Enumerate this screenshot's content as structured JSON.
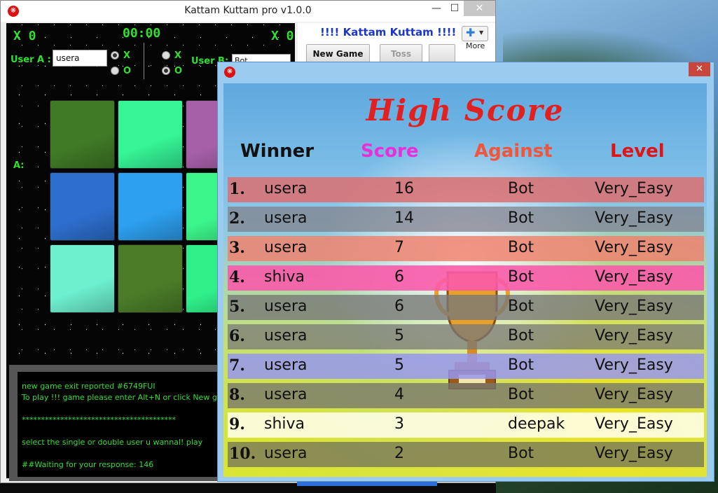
{
  "main_window": {
    "title": "Kattam Kuttam pro v1.0.0",
    "app_icon": "❋",
    "min": "—",
    "max": "☐",
    "close": "✕"
  },
  "game": {
    "score_a": "X 0",
    "score_b": "X 0",
    "timer": "00:00",
    "user_a_label": "User A :",
    "user_a_value": "usera",
    "user_b_label": "User B:",
    "user_b_value": "Bot",
    "x_label": "X",
    "o_label": "O",
    "side_label": "A:"
  },
  "right_panel": {
    "title": "!!!! Kattam Kuttam !!!!",
    "new_game": "New Game",
    "toss": "Toss",
    "more": "More"
  },
  "log": {
    "lines": [
      "new game exit reported #6749FUI",
      "To play !!! game please enter Alt+N or click New game",
      "****************************************",
      " select the single or double user u wannal! play",
      "##Waiting for your response: 146"
    ]
  },
  "high_score": {
    "title": "High Score",
    "close": "✕",
    "columns": [
      "Winner",
      "Score",
      "Against",
      "Level"
    ],
    "column_colors": [
      "#111111",
      "#ea2fd8",
      "#f2553a",
      "#e01414"
    ],
    "rows": [
      {
        "rank": "1.",
        "winner": "usera",
        "score": "16",
        "against": "Bot",
        "level": "Very_Easy",
        "color": "rgba(220,110,110,0.85)"
      },
      {
        "rank": "2.",
        "winner": "usera",
        "score": "14",
        "against": "Bot",
        "level": "Very_Easy",
        "color": "rgba(130,130,140,0.75)"
      },
      {
        "rank": "3.",
        "winner": "usera",
        "score": "7",
        "against": "Bot",
        "level": "Very_Easy",
        "color": "rgba(240,130,110,0.85)"
      },
      {
        "rank": "4.",
        "winner": "shiva",
        "score": "6",
        "against": "Bot",
        "level": "Very_Easy",
        "color": "rgba(250,90,170,0.9)"
      },
      {
        "rank": "5.",
        "winner": "usera",
        "score": "6",
        "against": "Bot",
        "level": "Very_Easy",
        "color": "rgba(120,120,120,0.8)"
      },
      {
        "rank": "6.",
        "winner": "usera",
        "score": "5",
        "against": "Bot",
        "level": "Very_Easy",
        "color": "rgba(120,120,120,0.75)"
      },
      {
        "rank": "7.",
        "winner": "usera",
        "score": "5",
        "against": "Bot",
        "level": "Very_Easy",
        "color": "rgba(150,150,240,0.85)"
      },
      {
        "rank": "8.",
        "winner": "usera",
        "score": "4",
        "against": "Bot",
        "level": "Very_Easy",
        "color": "rgba(120,120,110,0.8)"
      },
      {
        "rank": "9.",
        "winner": "shiva",
        "score": "3",
        "against": "deepak",
        "level": "Very_Easy",
        "color": "rgba(255,255,240,0.85)"
      },
      {
        "rank": "10.",
        "winner": "usera",
        "score": "2",
        "against": "Bot",
        "level": "Very_Easy",
        "color": "rgba(120,120,90,0.8)"
      }
    ]
  },
  "tile_colors": [
    "#3f7a25",
    "#36f596",
    "#a660a8",
    "#2d6fcf",
    "#2da0f0",
    "#3cf58a",
    "#6ef0cf",
    "#4b7d28",
    "#30f08a"
  ]
}
